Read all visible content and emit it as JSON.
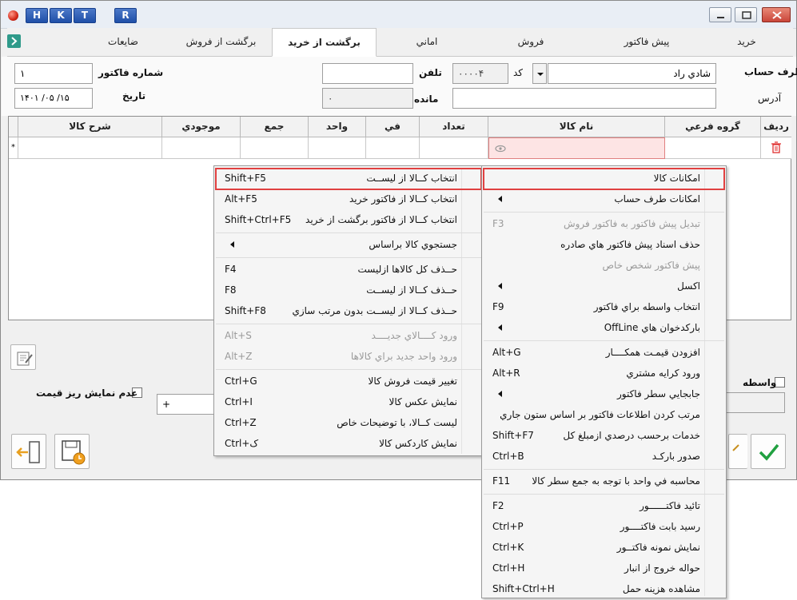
{
  "titlebar": {
    "quick_buttons": [
      "H",
      "K",
      "T",
      "R"
    ]
  },
  "tabs": [
    {
      "label": "خريد",
      "active": false
    },
    {
      "label": "پيش فاکتور",
      "active": false
    },
    {
      "label": "فروش",
      "active": false
    },
    {
      "label": "اماني",
      "active": false
    },
    {
      "label": "برگشت از خريد",
      "active": true
    },
    {
      "label": "برگشت از فروش",
      "active": false
    },
    {
      "label": "ضايعات",
      "active": false
    }
  ],
  "form": {
    "account_label": "طرف حساب",
    "account_value": "شادي راد",
    "code_label": "کد",
    "code_value": "۰۰۰۰۴",
    "phone_label": "تلفن",
    "phone_value": "",
    "invoice_no_label": "شماره فاکتور",
    "invoice_no_value": "۱",
    "address_label": "آدرس",
    "address_value": "",
    "balance_label": "مانده",
    "balance_value": "۰",
    "date_label": "تاريخ",
    "date_value": "۱۴۰۱ /۰۵ /۱۵"
  },
  "grid": {
    "columns": [
      "رديف",
      "گروه فرعي",
      "نام کالا",
      "تعداد",
      "في",
      "واحد",
      "جمع",
      "موجودي",
      "شرح کالا"
    ],
    "new_row_marker": "*"
  },
  "lower": {
    "hide_price_label": "عدم نمايش ريز قيمت",
    "broker_label": "واسطه",
    "plus_value": "+"
  },
  "left_menu": {
    "items": [
      {
        "label": "انتخاب کــالا از ليســت",
        "shortcut": "Shift+F5",
        "disabled": false,
        "submenu": false,
        "highlighted": true
      },
      {
        "label": "انتخاب کــالا از فاکتور خريد",
        "shortcut": "Alt+F5",
        "disabled": false,
        "submenu": false
      },
      {
        "label": "انتخاب کــالا از فاکتور برگشت از خريد",
        "shortcut": "Shift+Ctrl+F5",
        "disabled": false,
        "submenu": false
      },
      {
        "label": "جستجوي کالا براساس",
        "shortcut": "",
        "disabled": false,
        "submenu": true
      },
      {
        "label": "حــذف کل کالاها ازليست",
        "shortcut": "F4",
        "disabled": false,
        "submenu": false
      },
      {
        "label": "حــذف کــالا از ليســت",
        "shortcut": "F8",
        "disabled": false,
        "submenu": false
      },
      {
        "label": "حــذف کــالا از ليســت بدون مرتب سازي",
        "shortcut": "Shift+F8",
        "disabled": false,
        "submenu": false
      },
      {
        "label": "ورود کــــالاي جديــــد",
        "shortcut": "Alt+S",
        "disabled": true,
        "submenu": false
      },
      {
        "label": "ورود واحد جديد براي کالاها",
        "shortcut": "Alt+Z",
        "disabled": true,
        "submenu": false
      },
      {
        "label": "تغيير قيمت فروش کالا",
        "shortcut": "Ctrl+G",
        "disabled": false,
        "submenu": false
      },
      {
        "label": "نمايش عکس کالا",
        "shortcut": "Ctrl+I",
        "disabled": false,
        "submenu": false
      },
      {
        "label": "ليست کــالا، با توضيحات خاص",
        "shortcut": "Ctrl+Z",
        "disabled": false,
        "submenu": false
      },
      {
        "label": "نمايش کاردکس کالا",
        "shortcut": "Ctrl+ک",
        "disabled": false,
        "submenu": false
      }
    ]
  },
  "right_menu": {
    "items": [
      {
        "label": "امکانات کالا",
        "shortcut": "",
        "disabled": false,
        "submenu": false,
        "highlighted": true
      },
      {
        "label": "امکانات طرف حساب",
        "shortcut": "",
        "disabled": false,
        "submenu": true
      },
      {
        "label": "تبديل پيش فاکتور به فاکتور فروش",
        "shortcut": "F3",
        "disabled": true,
        "submenu": false
      },
      {
        "label": "حذف اسناد پيش فاکتور هاي صادره",
        "shortcut": "",
        "disabled": false,
        "submenu": false
      },
      {
        "label": "پيش فاکتور شخص خاص",
        "shortcut": "",
        "disabled": true,
        "submenu": false
      },
      {
        "label": "اکسل",
        "shortcut": "",
        "disabled": false,
        "submenu": true
      },
      {
        "label": "انتخاب واسطه براي فاکتور",
        "shortcut": "F9",
        "disabled": false,
        "submenu": false
      },
      {
        "label": "بارکدخوان هاي OffLine",
        "shortcut": "",
        "disabled": false,
        "submenu": true
      },
      {
        "label": "افزودن قيمـت همکــــار",
        "shortcut": "Alt+G",
        "disabled": false,
        "submenu": false
      },
      {
        "label": "ورود کرايه مشتري",
        "shortcut": "Alt+R",
        "disabled": false,
        "submenu": false
      },
      {
        "label": "جابجايي سطر فاکتور",
        "shortcut": "",
        "disabled": false,
        "submenu": true
      },
      {
        "label": "مرتب کردن اطلاعات فاکتور بر اساس ستون جاري",
        "shortcut": "",
        "disabled": false,
        "submenu": false
      },
      {
        "label": "خدمات برحسب درصدي ازمبلغ کل",
        "shortcut": "Shift+F7",
        "disabled": false,
        "submenu": false
      },
      {
        "label": "صدور بارکـد",
        "shortcut": "Ctrl+B",
        "disabled": false,
        "submenu": false
      },
      {
        "label": "محاسبه في واحد با توجه به جمع سطر کالا",
        "shortcut": "F11",
        "disabled": false,
        "submenu": false
      },
      {
        "label": "تائيد فاکتــــــور",
        "shortcut": "F2",
        "disabled": false,
        "submenu": false
      },
      {
        "label": "رسيد بابت فاکتــــور",
        "shortcut": "Ctrl+P",
        "disabled": false,
        "submenu": false
      },
      {
        "label": "نمايش نمونه فاکتــور",
        "shortcut": "Ctrl+K",
        "disabled": false,
        "submenu": false
      },
      {
        "label": "حواله خروج از انبار",
        "shortcut": "Ctrl+H",
        "disabled": false,
        "submenu": false
      },
      {
        "label": "مشاهده هزينه حمل",
        "shortcut": "Shift+Ctrl+H",
        "disabled": false,
        "submenu": false
      }
    ]
  }
}
